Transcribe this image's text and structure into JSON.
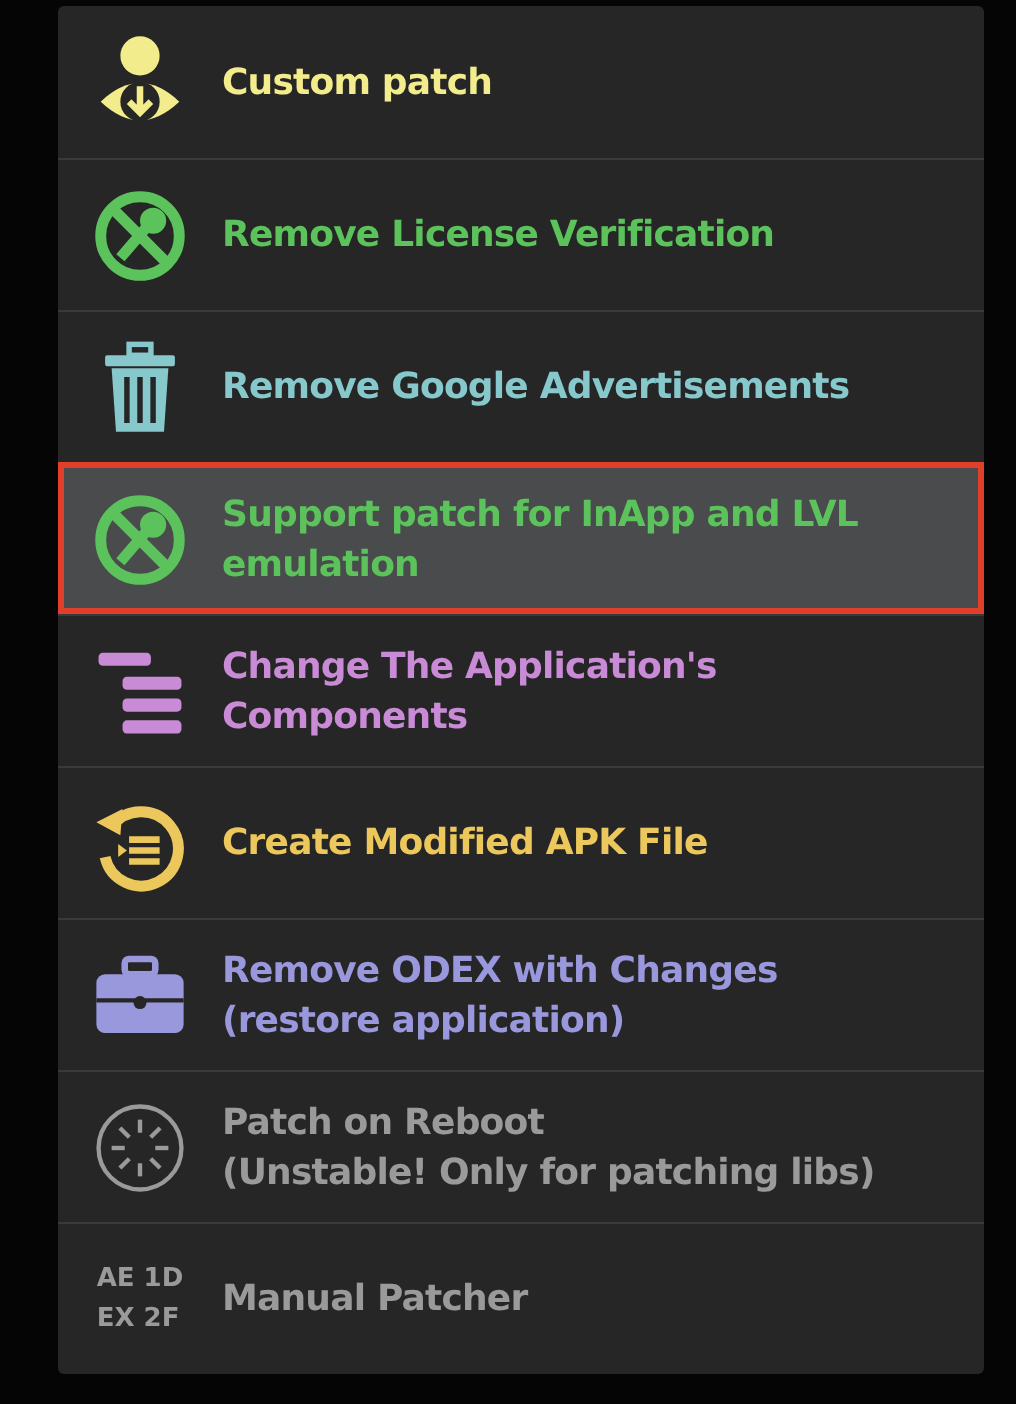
{
  "menu": {
    "items": [
      {
        "kind": "custom",
        "label": "Custom patch",
        "color": "#f2ec8c",
        "selected": false
      },
      {
        "kind": "nokey",
        "label": "Remove License Verification",
        "color": "#5cc35c",
        "selected": false
      },
      {
        "kind": "trash",
        "label": "Remove Google Advertisements",
        "color": "#86c8cc",
        "selected": false
      },
      {
        "kind": "nokey",
        "label": "Support patch for InApp and LVL emulation",
        "color": "#5cc35c",
        "selected": true
      },
      {
        "kind": "components",
        "label": "Change The Application's Components",
        "color": "#c98ad6",
        "selected": false
      },
      {
        "kind": "restore",
        "label": "Create Modified APK File",
        "color": "#ecc75c",
        "selected": false
      },
      {
        "kind": "toolbox",
        "label": "Remove ODEX with Changes (restore application)",
        "color": "#9a98dc",
        "selected": false
      },
      {
        "kind": "reboot",
        "label": "Patch on Reboot\n(Unstable! Only for patching libs)",
        "color": "#9a9a9a",
        "selected": false
      },
      {
        "kind": "hex",
        "label": "Manual Patcher",
        "color": "#9a9a9a",
        "selected": false,
        "icon_text": [
          "AE 1D",
          "EX 2F"
        ]
      }
    ]
  }
}
